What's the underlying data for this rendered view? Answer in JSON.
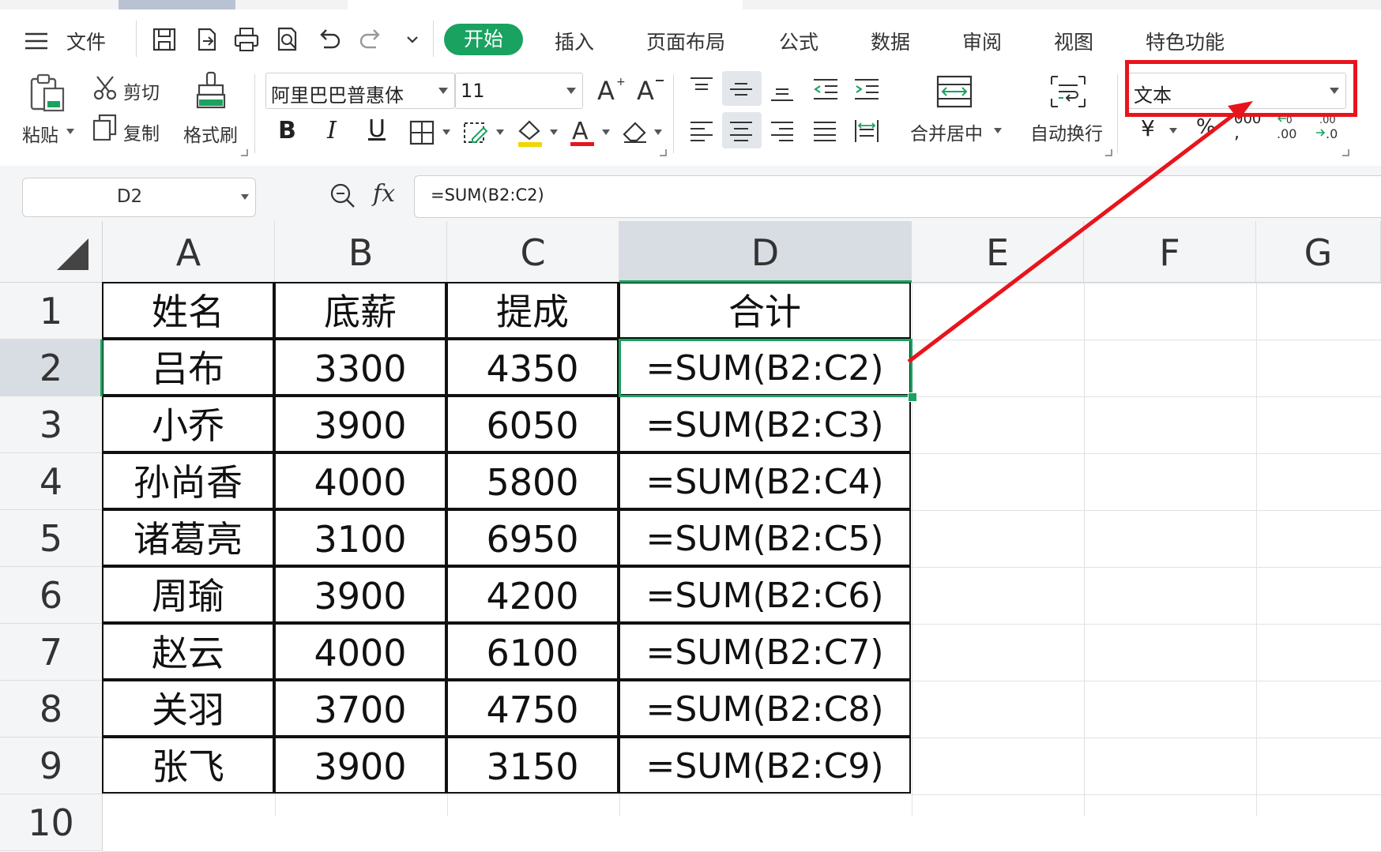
{
  "menu": {
    "file_label": "文件",
    "tabs": [
      "开始",
      "插入",
      "页面布局",
      "公式",
      "数据",
      "审阅",
      "视图",
      "特色功能"
    ]
  },
  "ribbon": {
    "paste_label": "粘贴",
    "cut_label": "剪切",
    "copy_label": "复制",
    "format_painter_label": "格式刷",
    "font_name": "阿里巴巴普惠体",
    "font_size": "11",
    "merge_label": "合并居中",
    "wrap_label": "自动换行",
    "number_format": "文本",
    "bold": "B",
    "italic": "I",
    "underline": "U",
    "currency_symbol": "¥",
    "percent_symbol": "%",
    "thousands_symbol": "000",
    "inc_decimal_label": ".00",
    "dec_decimal_label": ".0"
  },
  "formula_bar": {
    "name_box": "D2",
    "fx_label": "fx",
    "formula": "=SUM(B2:C2)"
  },
  "columns": [
    "A",
    "B",
    "C",
    "D",
    "E",
    "F",
    "G"
  ],
  "rows": [
    "1",
    "2",
    "3",
    "4",
    "5",
    "6",
    "7",
    "8",
    "9",
    "10"
  ],
  "table": {
    "headers": [
      "姓名",
      "底薪",
      "提成",
      "合计"
    ],
    "rows": [
      [
        "吕布",
        "3300",
        "4350",
        "=SUM(B2:C2)"
      ],
      [
        "小乔",
        "3900",
        "6050",
        "=SUM(B2:C3)"
      ],
      [
        "孙尚香",
        "4000",
        "5800",
        "=SUM(B2:C4)"
      ],
      [
        "诸葛亮",
        "3100",
        "6950",
        "=SUM(B2:C5)"
      ],
      [
        "周瑜",
        "3900",
        "4200",
        "=SUM(B2:C6)"
      ],
      [
        "赵云",
        "4000",
        "6100",
        "=SUM(B2:C7)"
      ],
      [
        "关羽",
        "3700",
        "4750",
        "=SUM(B2:C8)"
      ],
      [
        "张飞",
        "3900",
        "3150",
        "=SUM(B2:C9)"
      ]
    ]
  },
  "colors": {
    "accent_green": "#1aa260",
    "annotation_red": "#e8141c"
  }
}
